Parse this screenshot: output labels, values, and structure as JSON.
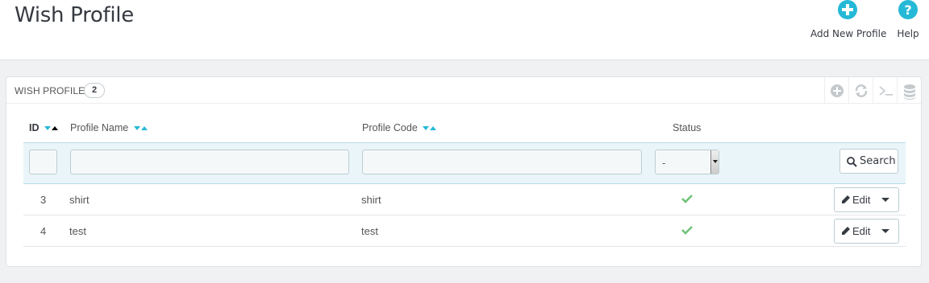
{
  "page": {
    "title": "Wish Profile"
  },
  "toolbar": {
    "add_label": "Add New Profile",
    "help_label": "Help"
  },
  "panel": {
    "title": "WISH PROFILE",
    "count": "2"
  },
  "table": {
    "columns": {
      "id": "ID",
      "profile_name": "Profile Name",
      "profile_code": "Profile Code",
      "status": "Status"
    },
    "filter": {
      "status_selected": "-",
      "search_label": "Search"
    },
    "rows": [
      {
        "id": "3",
        "profile_name": "shirt",
        "profile_code": "shirt",
        "status": "enabled",
        "edit_label": "Edit"
      },
      {
        "id": "4",
        "profile_name": "test",
        "profile_code": "test",
        "status": "enabled",
        "edit_label": "Edit"
      }
    ]
  },
  "colors": {
    "accent": "#25b9d7",
    "success": "#72c279",
    "filter_bg": "#eaf5f9"
  },
  "icons": {
    "add": "plus-circle-icon",
    "help": "question-circle-icon",
    "panel_actions": [
      "plus-circle-icon",
      "refresh-icon",
      "terminal-icon",
      "database-icon"
    ],
    "search": "search-icon",
    "edit": "pencil-icon",
    "status": "check-icon"
  }
}
